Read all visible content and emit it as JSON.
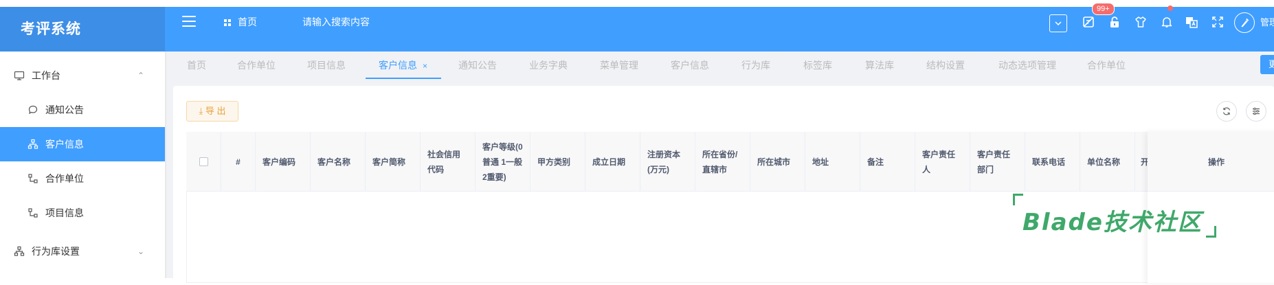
{
  "app": {
    "title": "考评系统"
  },
  "header": {
    "home_label": "首页",
    "search_placeholder": "请输入搜索内容",
    "badge_count": "99+",
    "user_label": "管理",
    "icons": [
      "chevron-down-icon",
      "no-screen-icon",
      "lock-icon",
      "shirt-icon",
      "bell-icon",
      "language-icon",
      "fullscreen-icon"
    ]
  },
  "sidebar": {
    "items": [
      {
        "label": "工作台",
        "icon": "monitor-icon",
        "arrow": "⌃"
      },
      {
        "label": "通知公告",
        "icon": "chat-bubble-icon"
      },
      {
        "label": "客户信息",
        "icon": "org-chart-icon",
        "active": true
      },
      {
        "label": "合作单位",
        "icon": "tree-icon"
      },
      {
        "label": "项目信息",
        "icon": "tree-icon"
      },
      {
        "label": "行为库设置",
        "icon": "org-chart-icon",
        "arrow": "⌄"
      }
    ]
  },
  "tabs": [
    {
      "label": "首页"
    },
    {
      "label": "合作单位"
    },
    {
      "label": "项目信息"
    },
    {
      "label": "客户信息",
      "active": true,
      "close": "×"
    },
    {
      "label": "通知公告"
    },
    {
      "label": "业务字典"
    },
    {
      "label": "菜单管理"
    },
    {
      "label": "客户信息"
    },
    {
      "label": "行为库"
    },
    {
      "label": "标签库"
    },
    {
      "label": "算法库"
    },
    {
      "label": "结构设置"
    },
    {
      "label": "动态选项管理"
    },
    {
      "label": "合作单位"
    }
  ],
  "right_button_label": "更",
  "toolbar": {
    "export_label": "导 出",
    "export_icon": "download-icon"
  },
  "table": {
    "columns": [
      {
        "label": ""
      },
      {
        "label": "#"
      },
      {
        "label": "客户编码"
      },
      {
        "label": "客户名称"
      },
      {
        "label": "客户简称"
      },
      {
        "label": "社会信用代码"
      },
      {
        "label": "客户等级(0普通 1一般 2重要)"
      },
      {
        "label": "甲方类别"
      },
      {
        "label": "成立日期"
      },
      {
        "label": "注册资本(万元)"
      },
      {
        "label": "所在省份/直辖市"
      },
      {
        "label": "所在城市"
      },
      {
        "label": "地址"
      },
      {
        "label": "备注"
      },
      {
        "label": "客户责任人"
      },
      {
        "label": "客户责任部门"
      },
      {
        "label": "联系电话"
      },
      {
        "label": "单位名称"
      },
      {
        "label": "开"
      }
    ],
    "ops_label": "操作"
  },
  "watermark": {
    "text": "Blade技术社区"
  },
  "colors": {
    "primary": "#409eff",
    "brand_bg": "#3d8ee6",
    "warning": "#e6a23c",
    "danger": "#f56c6c",
    "watermark": "#3fa86a"
  }
}
